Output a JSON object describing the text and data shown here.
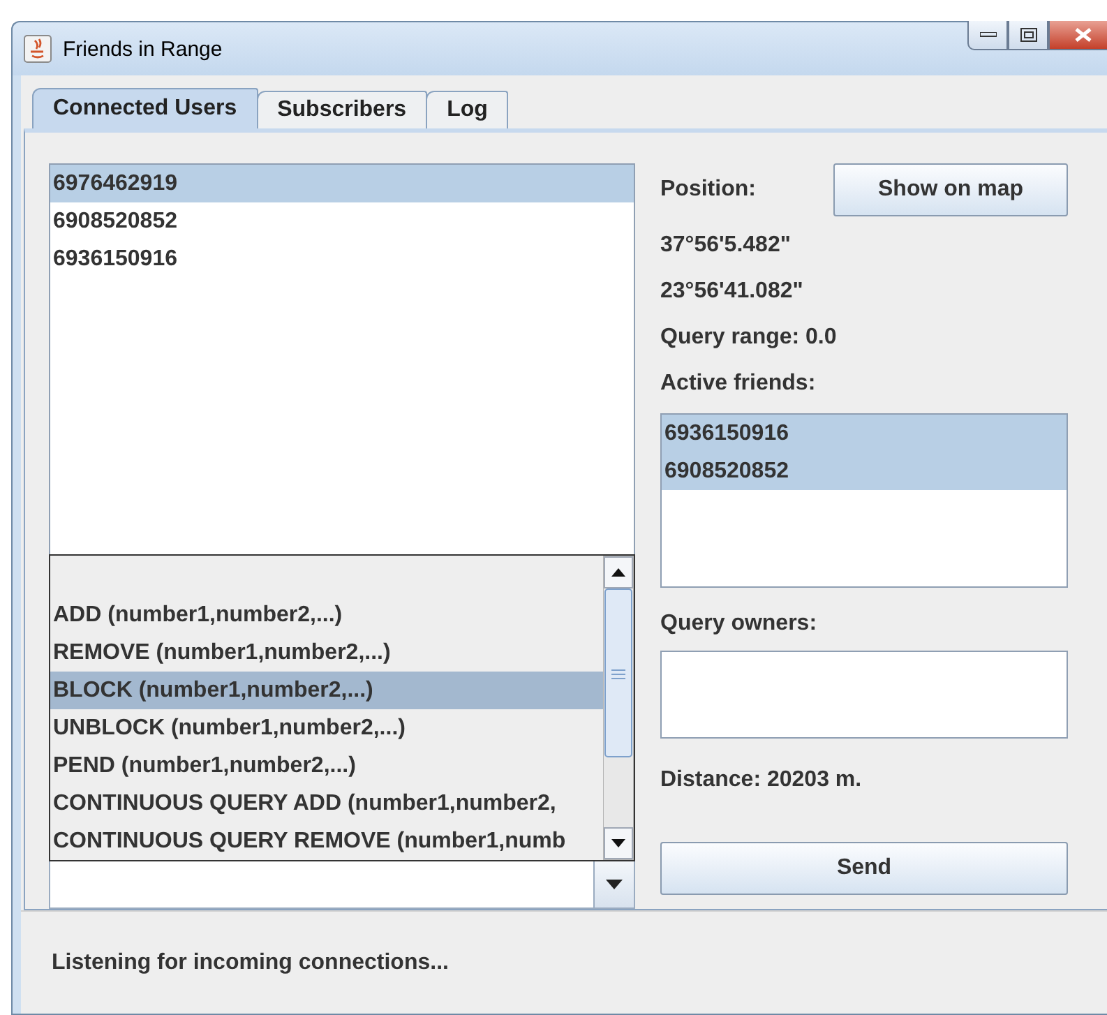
{
  "window": {
    "title": "Friends in Range"
  },
  "tabs": [
    {
      "label": "Connected Users",
      "selected": true
    },
    {
      "label": "Subscribers",
      "selected": false
    },
    {
      "label": "Log",
      "selected": false
    }
  ],
  "users": [
    {
      "number": "6976462919",
      "selected": true
    },
    {
      "number": "6908520852",
      "selected": false
    },
    {
      "number": "6936150916",
      "selected": false
    }
  ],
  "command_combo": {
    "expanded": true,
    "options": [
      {
        "label": "ADD (number1,number2,...)",
        "selected": false
      },
      {
        "label": "REMOVE (number1,number2,...)",
        "selected": false
      },
      {
        "label": "BLOCK (number1,number2,...)",
        "selected": true
      },
      {
        "label": "UNBLOCK (number1,number2,...)",
        "selected": false
      },
      {
        "label": "PEND (number1,number2,...)",
        "selected": false
      },
      {
        "label": "CONTINUOUS QUERY ADD (number1,number2,",
        "selected": false
      },
      {
        "label": "CONTINUOUS QUERY REMOVE (number1,numb",
        "selected": false
      }
    ]
  },
  "position_label": "Position:",
  "show_on_map_button": "Show on map",
  "latitude": "37°56'5.482\"",
  "longitude": "23°56'41.082\"",
  "query_range": "Query range: 0.0",
  "active_friends_label": "Active friends:",
  "active_friends": [
    {
      "number": "6936150916",
      "selected": true
    },
    {
      "number": "6908520852",
      "selected": true
    }
  ],
  "query_owners_label": "Query owners:",
  "distance": "Distance: 20203 m.",
  "send_button": "Send",
  "status": "Listening for incoming connections..."
}
